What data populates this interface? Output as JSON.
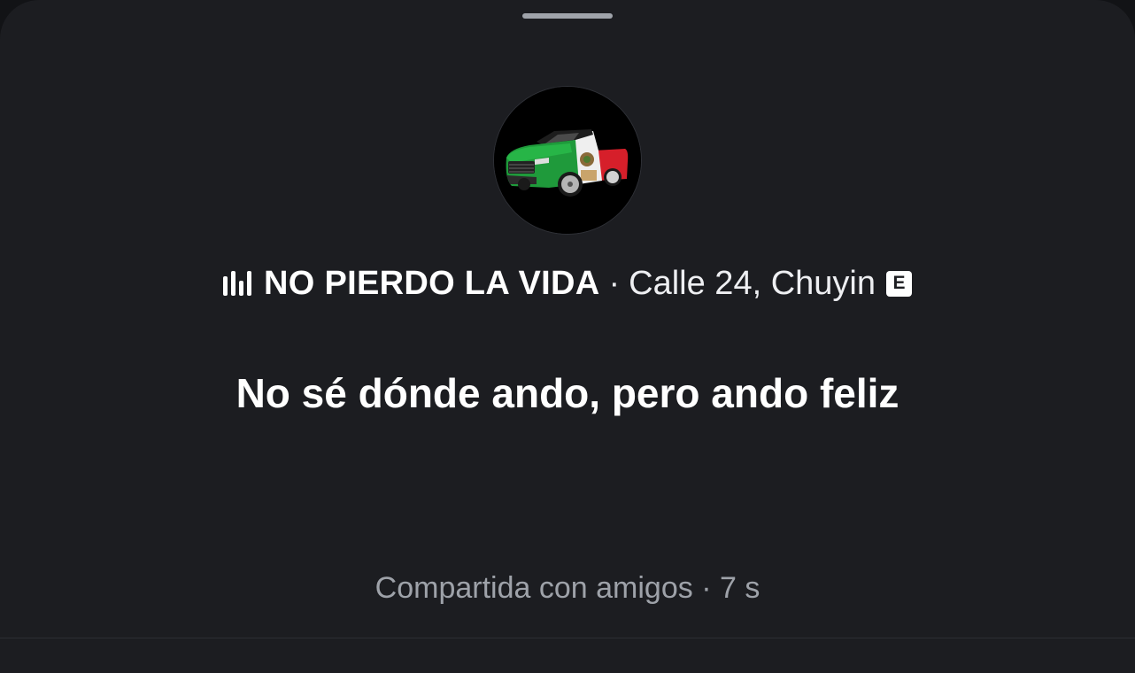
{
  "sheet": {
    "background": "#1c1d21",
    "accent": "#ffffff"
  },
  "avatar": {
    "name": "avatar-truck-mexico-flag"
  },
  "track": {
    "icon": "equalizer-icon",
    "title": "NO PIERDO LA VIDA",
    "separator": "·",
    "artist": "Calle 24, Chuyin",
    "explicit_badge": "E"
  },
  "note": {
    "text": "No sé dónde ando, pero ando feliz"
  },
  "meta": {
    "audience": "Compartida con amigos",
    "separator": "·",
    "time": "7 s"
  }
}
